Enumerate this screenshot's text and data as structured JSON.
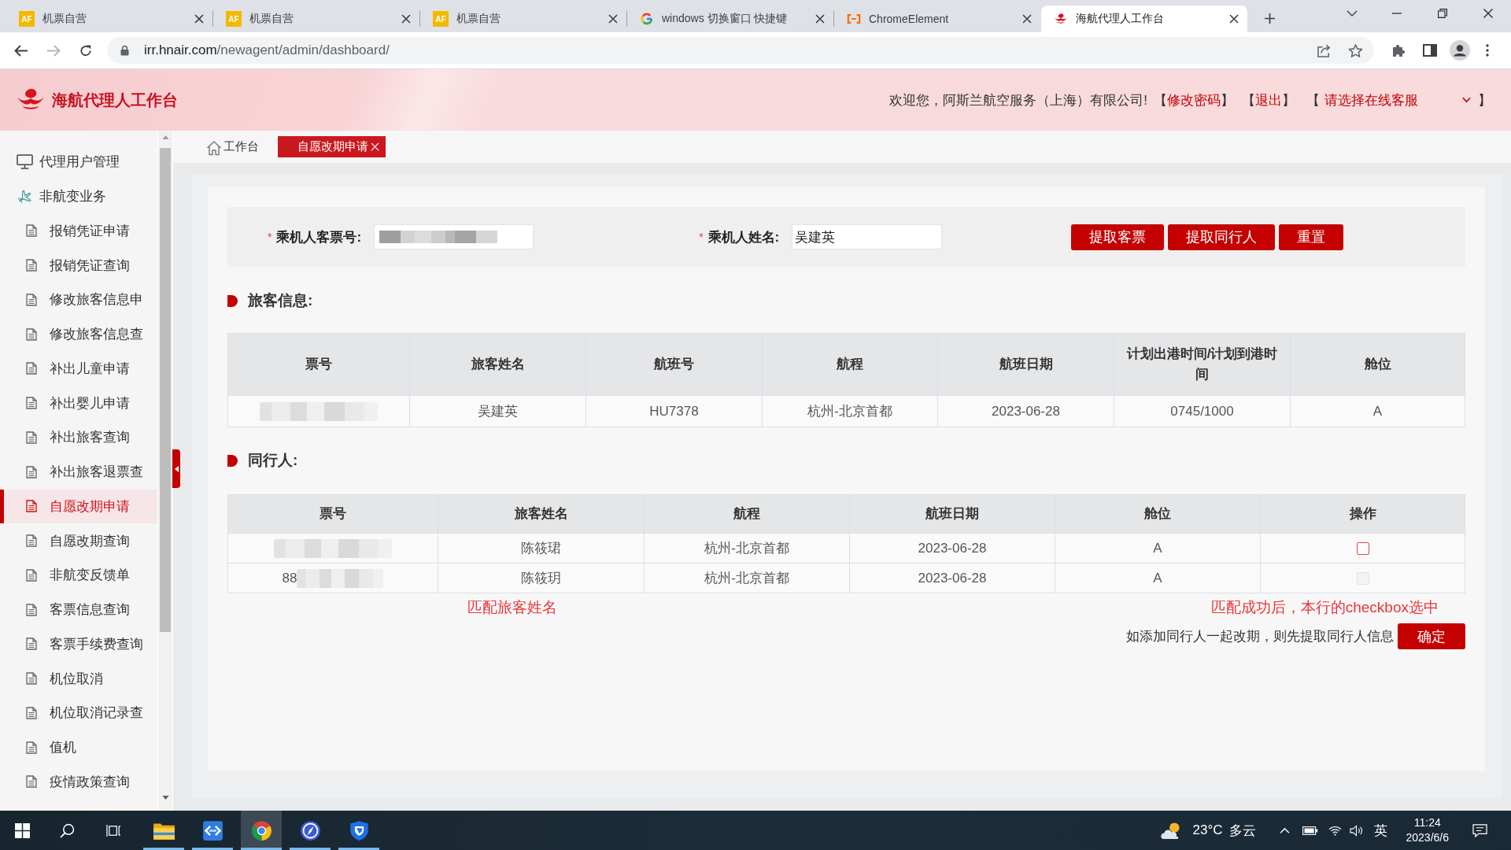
{
  "browser": {
    "tabs": [
      {
        "kind": "af",
        "badge": "AF",
        "title": "机票自营",
        "selected": false
      },
      {
        "kind": "af",
        "badge": "AF",
        "title": "机票自营",
        "selected": false
      },
      {
        "kind": "af",
        "badge": "AF",
        "title": "机票自营",
        "selected": false
      },
      {
        "kind": "ring",
        "title": "windows 切换窗口 快捷键",
        "selected": false
      },
      {
        "kind": "bracket",
        "title": "ChromeElement",
        "selected": false
      },
      {
        "kind": "emblem",
        "title": "海航代理人工作台",
        "selected": true
      }
    ],
    "url": {
      "host": "irr.hnair.com",
      "path": "/newagent/admin/dashboard/"
    }
  },
  "header": {
    "title": "海航代理人工作台",
    "welcome": "欢迎您，阿斯兰航空服务（上海）有限公司!",
    "links": [
      {
        "open": "【",
        "label": "修改密码",
        "close": "】"
      },
      {
        "open": "【",
        "label": "退出",
        "close": "】"
      }
    ],
    "service_select": {
      "open": "【",
      "placeholder": "请选择在线客服",
      "close": "】"
    }
  },
  "sidebar": {
    "items": [
      {
        "kind": "monitor",
        "label": "代理用户管理",
        "selected": false
      },
      {
        "kind": "plane",
        "label": "非航变业务",
        "selected": false,
        "children": [
          {
            "label": "报销凭证申请",
            "selected": false
          },
          {
            "label": "报销凭证查询",
            "selected": false
          },
          {
            "label": "修改旅客信息申",
            "selected": false
          },
          {
            "label": "修改旅客信息查",
            "selected": false
          },
          {
            "label": "补出儿童申请",
            "selected": false
          },
          {
            "label": "补出婴儿申请",
            "selected": false
          },
          {
            "label": "补出旅客查询",
            "selected": false
          },
          {
            "label": "补出旅客退票查",
            "selected": false
          },
          {
            "label": "自愿改期申请",
            "selected": true
          },
          {
            "label": "自愿改期查询",
            "selected": false
          },
          {
            "label": "非航变反馈单",
            "selected": false
          },
          {
            "label": "客票信息查询",
            "selected": false
          },
          {
            "label": "客票手续费查询",
            "selected": false
          },
          {
            "label": "机位取消",
            "selected": false
          },
          {
            "label": "机位取消记录查",
            "selected": false
          },
          {
            "label": "值机",
            "selected": false
          },
          {
            "label": "疫情政策查询",
            "selected": false
          }
        ]
      }
    ]
  },
  "page_tabs": [
    {
      "kind": "home",
      "label": "工作台",
      "selected": false,
      "closable": false
    },
    {
      "kind": "plain",
      "label": "自愿改期申请",
      "selected": true,
      "closable": true
    }
  ],
  "form": {
    "fields": [
      {
        "mark": "*",
        "label": "乘机人客票号:",
        "kind": "redacted"
      },
      {
        "mark": "*",
        "label": "乘机人姓名:",
        "kind": "text",
        "value": "吴建英"
      }
    ],
    "buttons": [
      "提取客票",
      "提取同行人",
      "重置"
    ]
  },
  "passenger_info": {
    "title": "旅客信息:",
    "columns": [
      "票号",
      "旅客姓名",
      "航班号",
      "航程",
      "航班日期",
      "计划出港时间/计划到港时间",
      "舱位"
    ],
    "rows": [
      {
        "redacted": true,
        "cells": [
          "",
          "吴建英",
          "HU7378",
          "杭州-北京首都",
          "2023-06-28",
          "0745/1000",
          "A"
        ]
      }
    ]
  },
  "companions": {
    "title": "同行人:",
    "columns": [
      "票号",
      "旅客姓名",
      "航程",
      "航班日期",
      "舱位",
      "操作"
    ],
    "rows": [
      {
        "redacted": true,
        "cells": [
          "",
          "陈筱珺",
          "杭州-北京首都",
          "2023-06-28",
          "A"
        ],
        "checked": false,
        "disabled": false
      },
      {
        "redacted": true,
        "cells": [
          "88",
          "陈筱玥",
          "杭州-北京首都",
          "2023-06-28",
          "A"
        ],
        "checked": false,
        "disabled": true
      }
    ]
  },
  "annotations": [
    "匹配旅客姓名",
    "匹配成功后，本行的checkbox选中"
  ],
  "footer": {
    "hint": "如添加同行人一起改期，则先提取同行人信息",
    "button": "确定"
  },
  "taskbar": {
    "apps": [
      {
        "kind": "folder",
        "selected": false
      },
      {
        "kind": "remote",
        "selected": false
      },
      {
        "kind": "browser",
        "selected": true
      },
      {
        "kind": "compass",
        "selected": false
      },
      {
        "kind": "shield",
        "selected": false
      }
    ],
    "weather": {
      "temperature": "23°C",
      "condition": "多云"
    },
    "input_method": "英",
    "time": "11:24",
    "date": "2023/6/6"
  }
}
